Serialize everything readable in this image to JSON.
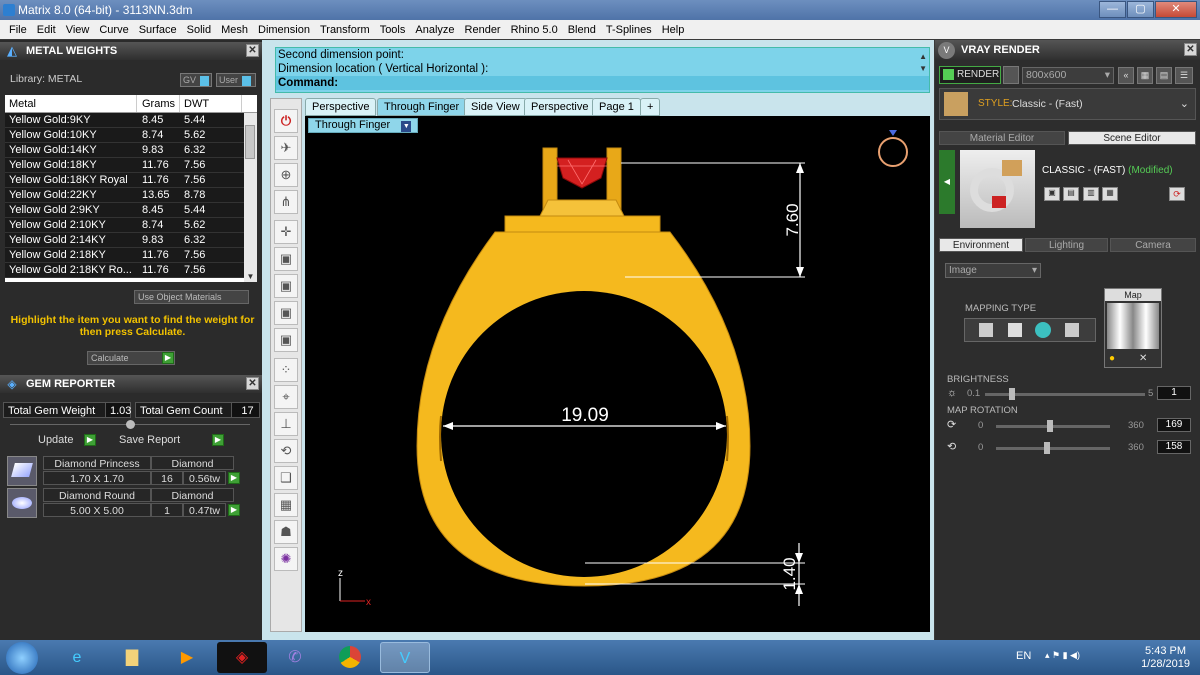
{
  "window": {
    "title": "Matrix 8.0 (64-bit) - 3113NN.3dm",
    "min": "—",
    "max": "▢",
    "close": "✕"
  },
  "menu": [
    "File",
    "Edit",
    "View",
    "Curve",
    "Surface",
    "Solid",
    "Mesh",
    "Dimension",
    "Transform",
    "Tools",
    "Analyze",
    "Render",
    "Rhino 5.0",
    "Blend",
    "T-Splines",
    "Help"
  ],
  "metal": {
    "title": "METAL WEIGHTS",
    "library_label": "Library: METAL",
    "gv_label": "GV",
    "user_label": "User",
    "columns": [
      "Metal",
      "Grams",
      "DWT"
    ],
    "rows": [
      [
        "Yellow Gold:9KY",
        "8.45",
        "5.44"
      ],
      [
        "Yellow Gold:10KY",
        "8.74",
        "5.62"
      ],
      [
        "Yellow Gold:14KY",
        "9.83",
        "6.32"
      ],
      [
        "Yellow Gold:18KY",
        "11.76",
        "7.56"
      ],
      [
        "Yellow Gold:18KY Royal",
        "11.76",
        "7.56"
      ],
      [
        "Yellow Gold:22KY",
        "13.65",
        "8.78"
      ],
      [
        "Yellow Gold 2:9KY",
        "8.45",
        "5.44"
      ],
      [
        "Yellow Gold 2:10KY",
        "8.74",
        "5.62"
      ],
      [
        "Yellow Gold 2:14KY",
        "9.83",
        "6.32"
      ],
      [
        "Yellow Gold 2:18KY",
        "11.76",
        "7.56"
      ],
      [
        "Yellow Gold 2:18KY Ro...",
        "11.76",
        "7.56"
      ]
    ],
    "use_object_materials": "Use Object Materials",
    "hint": "Highlight the item you want to find the weight for then press Calculate.",
    "calculate": "Calculate"
  },
  "gem": {
    "title": "GEM REPORTER",
    "total_weight_label": "Total Gem Weight",
    "total_weight": "1.03",
    "total_count_label": "Total Gem Count",
    "total_count": "17",
    "update": "Update",
    "save_report": "Save Report",
    "items": [
      {
        "name": "Diamond Princess",
        "type": "Diamond",
        "size": "1.70 X 1.70",
        "count": "16",
        "weight": "0.56tw"
      },
      {
        "name": "Diamond Round",
        "type": "Diamond",
        "size": "5.00 X 5.00",
        "count": "1",
        "weight": "0.47tw"
      }
    ]
  },
  "command": {
    "line1": "Second dimension point:",
    "line2": "Dimension location ( Vertical  Horizontal ):",
    "prompt": "Command:"
  },
  "tabs": [
    "Perspective",
    "Through Finger",
    "Side View",
    "Perspective",
    "Page 1",
    "+"
  ],
  "viewport": {
    "label": "Through Finger",
    "dims": {
      "height": "7.60",
      "width": "19.09",
      "bottom": "1.40"
    },
    "axis_z": "z",
    "axis_x": "x"
  },
  "vray": {
    "title": "VRAY RENDER",
    "render": "RENDER",
    "resolution": "800x600",
    "style_label": "STYLE:",
    "style_value": "Classic - (Fast)",
    "tabs": [
      "Material Editor",
      "Scene Editor"
    ],
    "preset": "CLASSIC - (FAST)",
    "modified": "(Modified)",
    "subtabs": [
      "Environment",
      "Lighting",
      "Camera"
    ],
    "dropdown": "Image",
    "mapping_type": "MAPPING TYPE",
    "map_label": "Map",
    "brightness_label": "BRIGHTNESS",
    "brightness_min": "0.1",
    "brightness_max": "5",
    "brightness_value": "1",
    "map_rotation_label": "MAP ROTATION",
    "rot1_min": "0",
    "rot1_max": "360",
    "rot1_value": "169",
    "rot2_min": "0",
    "rot2_max": "360",
    "rot2_value": "158"
  },
  "taskbar": {
    "lang": "EN",
    "time": "5:43 PM",
    "date": "1/28/2019"
  },
  "colors": {
    "gold": "#f5b91e",
    "gem": "#d42020",
    "cmd_bg": "#7dd3ea"
  }
}
